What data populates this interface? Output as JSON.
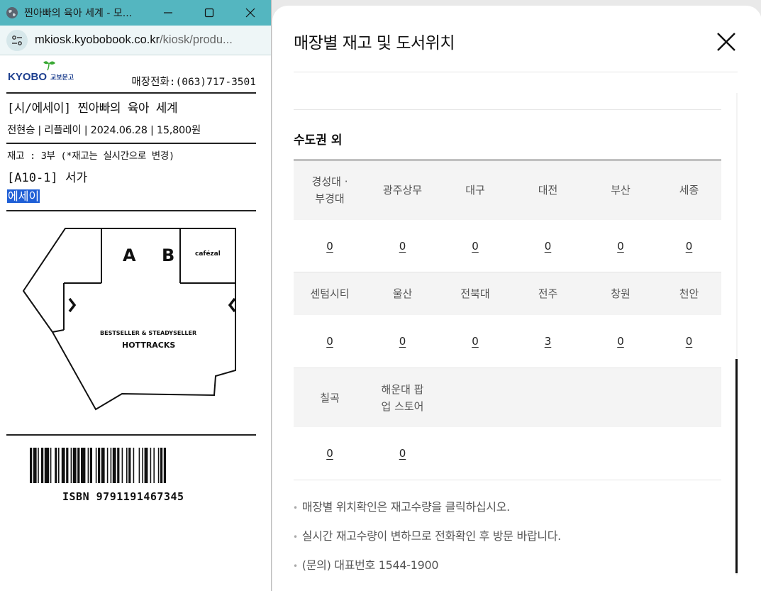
{
  "window": {
    "title": "찐아빠의 육아 세계 - 모...",
    "url_host": "mkiosk.kyobobook.co.kr",
    "url_path": "/kiosk/produ..."
  },
  "kiosk": {
    "logo_text": "KYOBO",
    "logo_sub": "교보문고",
    "phone": "매장전화:(063)717-3501",
    "book_title": "[시/에세이] 찐아빠의 육아 세계",
    "book_meta": "전현승 | 리플레이 | 2024.06.28 | 15,800원",
    "stock_line": "재고 : 3부 (*재고는 실시간으로 변경)",
    "location_line": "[A10-1] 서가",
    "genre": "에세이",
    "map": {
      "label_a": "A",
      "label_b": "B",
      "label_cafe": "cafézal",
      "label_seller": "BESTSELLER & STEADYSELLER",
      "label_hottracks": "HOTTRACKS"
    },
    "isbn": "ISBN 9791191467345"
  },
  "modal": {
    "title": "매장별 재고 및 도서위치",
    "region_title": "수도권 외",
    "rows": [
      {
        "headers": [
          "경성대 · 부경대",
          "광주상무",
          "대구",
          "대전",
          "부산",
          "세종"
        ],
        "values": [
          "0",
          "0",
          "0",
          "0",
          "0",
          "0"
        ]
      },
      {
        "headers": [
          "센텀시티",
          "울산",
          "전북대",
          "전주",
          "창원",
          "천안"
        ],
        "values": [
          "0",
          "0",
          "0",
          "3",
          "0",
          "0"
        ]
      },
      {
        "headers": [
          "칠곡",
          "해운대 팝업 스토어",
          "",
          "",
          "",
          ""
        ],
        "values": [
          "0",
          "0",
          "",
          "",
          "",
          ""
        ]
      }
    ],
    "notes": [
      "매장별 위치확인은 재고수량을 클릭하십시오.",
      "실시간 재고수량이 변하므로 전화확인 후 방문 바랍니다.",
      "(문의) 대표번호 1544-1900"
    ]
  },
  "colors": {
    "titlebar": "#54b6c0",
    "highlight": "#1f5fd6",
    "logo_blue": "#1d3f8f",
    "logo_green": "#3aa935"
  }
}
